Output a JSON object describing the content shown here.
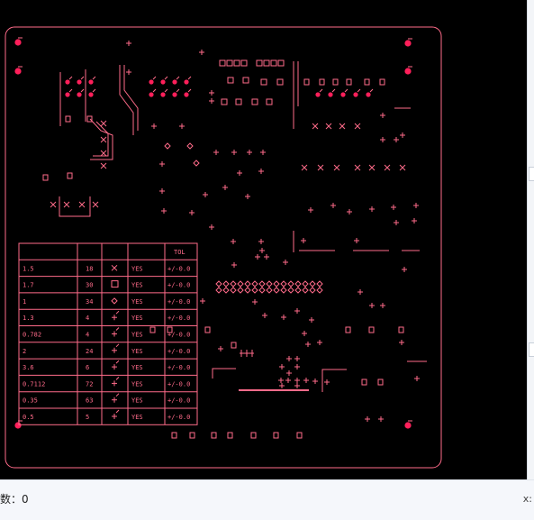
{
  "colors": {
    "background": "#000000",
    "trace": "#ff6b8a",
    "pad": "#ff1f5a",
    "statusbar": "#f5f7fb"
  },
  "status": {
    "left_text": "数：0",
    "right_text": "x:"
  },
  "drill_table": {
    "header_tol": "TOL",
    "rows": [
      {
        "size": "1.5",
        "qty": "18",
        "symbol": "x-icon",
        "plated": "YES",
        "tol": "+/-0.0"
      },
      {
        "size": "1.7",
        "qty": "30",
        "symbol": "square-icon",
        "plated": "YES",
        "tol": "+/-0.0"
      },
      {
        "size": "1",
        "qty": "34",
        "symbol": "diamond-icon",
        "plated": "YES",
        "tol": "+/-0.0"
      },
      {
        "size": "1.3",
        "qty": "4",
        "symbol": "plus-tick-icon",
        "plated": "YES",
        "tol": "+/-0.0"
      },
      {
        "size": "0.782",
        "qty": "4",
        "symbol": "plus-tick-icon",
        "plated": "YES",
        "tol": "+/-0.0"
      },
      {
        "size": "2",
        "qty": "24",
        "symbol": "plus-tick-icon",
        "plated": "YES",
        "tol": "+/-0.0"
      },
      {
        "size": "3.6",
        "qty": "6",
        "symbol": "plus-tick-icon",
        "plated": "YES",
        "tol": "+/-0.0"
      },
      {
        "size": "0.7112",
        "qty": "72",
        "symbol": "plus-tick-icon",
        "plated": "YES",
        "tol": "+/-0.0"
      },
      {
        "size": "0.35",
        "qty": "63",
        "symbol": "plus-tick-icon",
        "plated": "YES",
        "tol": "+/-0.0"
      },
      {
        "size": "0.5",
        "qty": "5",
        "symbol": "plus-tick-icon",
        "plated": "YES",
        "tol": "+/-0.0"
      }
    ]
  }
}
